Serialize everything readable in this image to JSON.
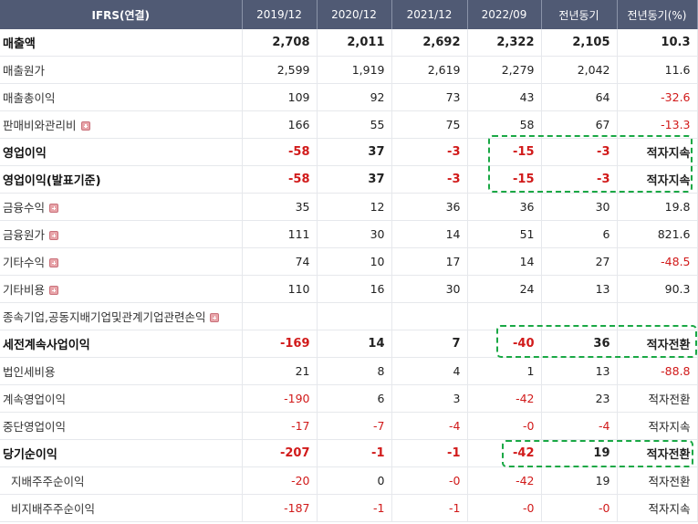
{
  "header": [
    "IFRS(연결)",
    "2019/12",
    "2020/12",
    "2021/12",
    "2022/09",
    "전년동기",
    "전년동기(%)"
  ],
  "rows": [
    {
      "label": "매출액",
      "bold": true,
      "plus": false,
      "indent": false,
      "values": [
        "2,708",
        "2,011",
        "2,692",
        "2,322",
        "2,105",
        "10.3"
      ],
      "neg": [
        false,
        false,
        false,
        false,
        false,
        false
      ]
    },
    {
      "label": "매출원가",
      "bold": false,
      "plus": false,
      "indent": false,
      "values": [
        "2,599",
        "1,919",
        "2,619",
        "2,279",
        "2,042",
        "11.6"
      ],
      "neg": [
        false,
        false,
        false,
        false,
        false,
        false
      ]
    },
    {
      "label": "매출총이익",
      "bold": false,
      "plus": false,
      "indent": false,
      "values": [
        "109",
        "92",
        "73",
        "43",
        "64",
        "-32.6"
      ],
      "neg": [
        false,
        false,
        false,
        false,
        false,
        true
      ]
    },
    {
      "label": "판매비와관리비",
      "bold": false,
      "plus": true,
      "indent": false,
      "values": [
        "166",
        "55",
        "75",
        "58",
        "67",
        "-13.3"
      ],
      "neg": [
        false,
        false,
        false,
        false,
        false,
        true
      ]
    },
    {
      "label": "영업이익",
      "bold": true,
      "plus": false,
      "indent": false,
      "values": [
        "-58",
        "37",
        "-3",
        "-15",
        "-3",
        "적자지속"
      ],
      "neg": [
        true,
        false,
        true,
        true,
        true,
        false
      ]
    },
    {
      "label": "영업이익(발표기준)",
      "bold": true,
      "plus": false,
      "indent": false,
      "values": [
        "-58",
        "37",
        "-3",
        "-15",
        "-3",
        "적자지속"
      ],
      "neg": [
        true,
        false,
        true,
        true,
        true,
        false
      ]
    },
    {
      "label": "금융수익",
      "bold": false,
      "plus": true,
      "indent": false,
      "values": [
        "35",
        "12",
        "36",
        "36",
        "30",
        "19.8"
      ],
      "neg": [
        false,
        false,
        false,
        false,
        false,
        false
      ]
    },
    {
      "label": "금융원가",
      "bold": false,
      "plus": true,
      "indent": false,
      "values": [
        "111",
        "30",
        "14",
        "51",
        "6",
        "821.6"
      ],
      "neg": [
        false,
        false,
        false,
        false,
        false,
        false
      ]
    },
    {
      "label": "기타수익",
      "bold": false,
      "plus": true,
      "indent": false,
      "values": [
        "74",
        "10",
        "17",
        "14",
        "27",
        "-48.5"
      ],
      "neg": [
        false,
        false,
        false,
        false,
        false,
        true
      ]
    },
    {
      "label": "기타비용",
      "bold": false,
      "plus": true,
      "indent": false,
      "values": [
        "110",
        "16",
        "30",
        "24",
        "13",
        "90.3"
      ],
      "neg": [
        false,
        false,
        false,
        false,
        false,
        false
      ]
    },
    {
      "label": "종속기업,공동지배기업및관계기업관련손익",
      "bold": false,
      "plus": true,
      "indent": false,
      "values": [
        "",
        "",
        "",
        "",
        "",
        ""
      ],
      "neg": [
        false,
        false,
        false,
        false,
        false,
        false
      ]
    },
    {
      "label": "세전계속사업이익",
      "bold": true,
      "plus": false,
      "indent": false,
      "values": [
        "-169",
        "14",
        "7",
        "-40",
        "36",
        "적자전환"
      ],
      "neg": [
        true,
        false,
        false,
        true,
        false,
        false
      ]
    },
    {
      "label": "법인세비용",
      "bold": false,
      "plus": false,
      "indent": false,
      "values": [
        "21",
        "8",
        "4",
        "1",
        "13",
        "-88.8"
      ],
      "neg": [
        false,
        false,
        false,
        false,
        false,
        true
      ]
    },
    {
      "label": "계속영업이익",
      "bold": false,
      "plus": false,
      "indent": false,
      "values": [
        "-190",
        "6",
        "3",
        "-42",
        "23",
        "적자전환"
      ],
      "neg": [
        true,
        false,
        false,
        true,
        false,
        false
      ]
    },
    {
      "label": "중단영업이익",
      "bold": false,
      "plus": false,
      "indent": false,
      "values": [
        "-17",
        "-7",
        "-4",
        "-0",
        "-4",
        "적자지속"
      ],
      "neg": [
        true,
        true,
        true,
        true,
        true,
        false
      ]
    },
    {
      "label": "당기순이익",
      "bold": true,
      "plus": false,
      "indent": false,
      "values": [
        "-207",
        "-1",
        "-1",
        "-42",
        "19",
        "적자전환"
      ],
      "neg": [
        true,
        true,
        true,
        true,
        false,
        false
      ]
    },
    {
      "label": "지배주주순이익",
      "bold": false,
      "plus": false,
      "indent": true,
      "values": [
        "-20",
        "0",
        "-0",
        "-42",
        "19",
        "적자전환"
      ],
      "neg": [
        true,
        false,
        true,
        true,
        false,
        false
      ]
    },
    {
      "label": "비지배주주순이익",
      "bold": false,
      "plus": false,
      "indent": true,
      "values": [
        "-187",
        "-1",
        "-1",
        "-0",
        "-0",
        "적자지속"
      ],
      "neg": [
        true,
        true,
        true,
        true,
        true,
        false
      ]
    }
  ],
  "colors": {
    "header_bg": "#505a74",
    "negative": "#d11a1a",
    "highlight": "#1aa845",
    "plus_icon": "#e8a5aa"
  }
}
